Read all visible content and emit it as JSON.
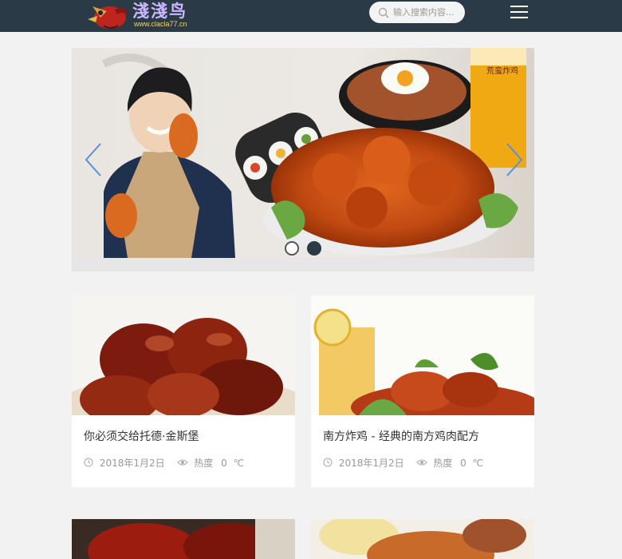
{
  "header": {
    "logo_title": "淺淺鸟",
    "logo_url": "www.clacla77.cn",
    "search_placeholder": "输入搜索内容...",
    "bar_color": "#2b3a47"
  },
  "banner": {
    "slide_count": 2,
    "active_slide": 2,
    "sign_text": "荒蛮炸鸡"
  },
  "posts": [
    {
      "title": "你必须交给托德·金斯堡",
      "date": "2018年1月2日",
      "heat_label": "热度",
      "heat_value": "0",
      "heat_unit": "℃"
    },
    {
      "title": "南方炸鸡 - 经典的南方鸡肉配方",
      "date": "2018年1月2日",
      "heat_label": "热度",
      "heat_value": "0",
      "heat_unit": "℃"
    }
  ]
}
